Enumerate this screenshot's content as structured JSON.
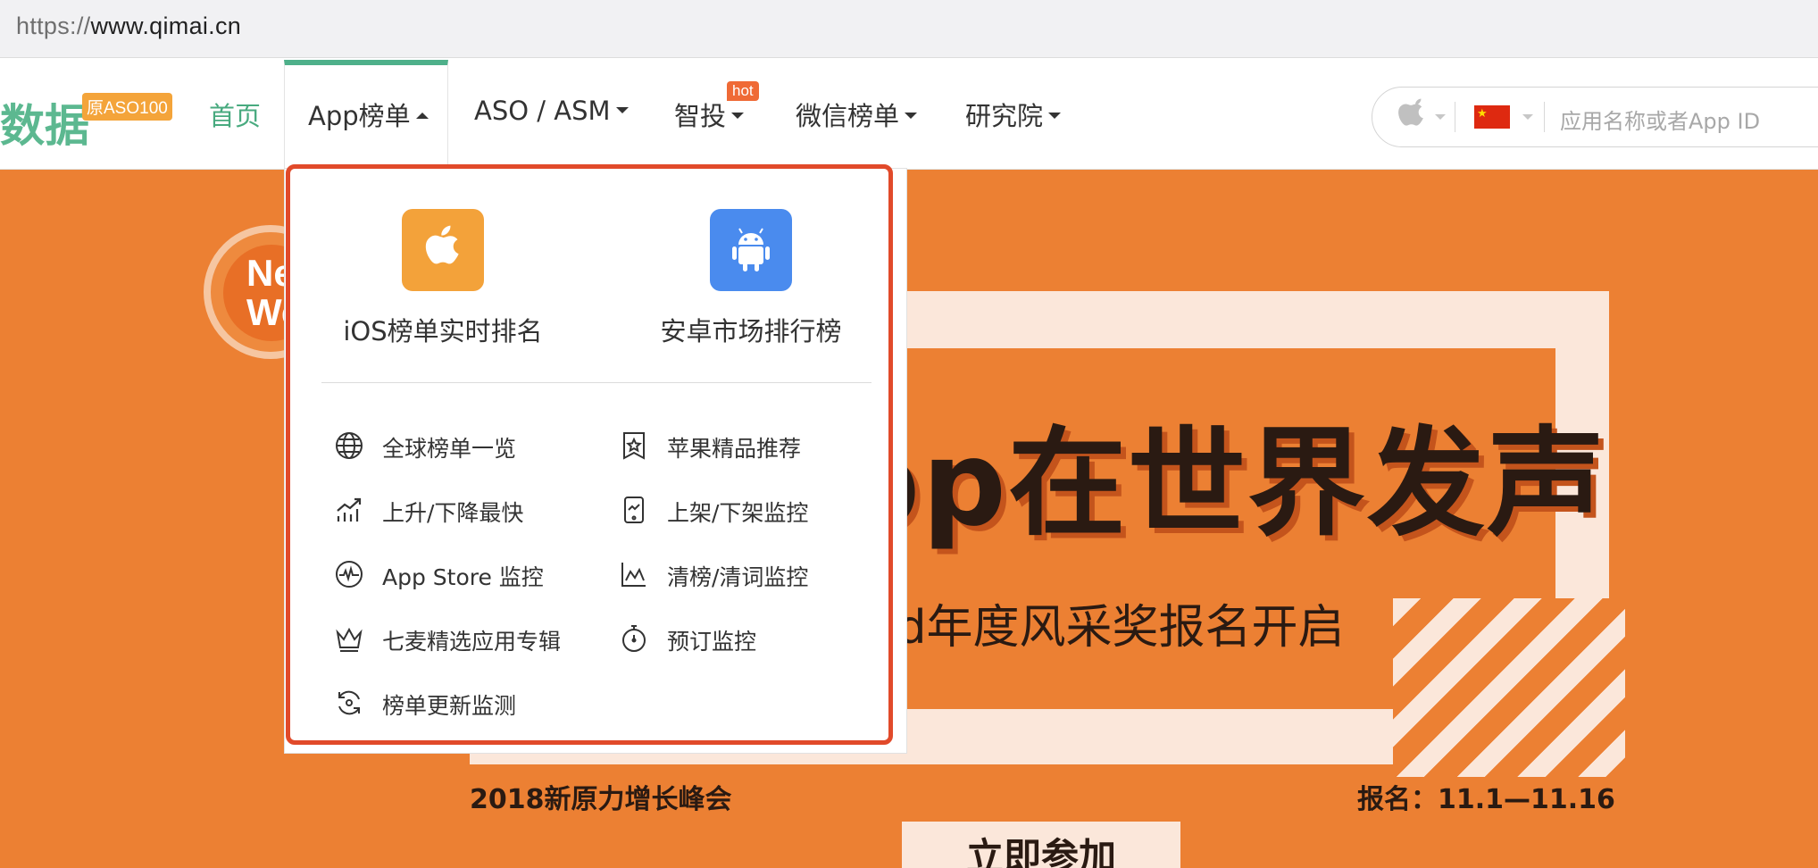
{
  "browser": {
    "url_scheme": "https://",
    "url_host": "www.qimai.cn"
  },
  "logo": {
    "text": "数据",
    "badge": "原ASO100"
  },
  "nav": {
    "home": "首页",
    "items": [
      {
        "label": "App榜单"
      },
      {
        "label": "ASO / ASM"
      },
      {
        "label": "智投",
        "badge": "hot"
      },
      {
        "label": "微信榜单"
      },
      {
        "label": "研究院"
      }
    ]
  },
  "search": {
    "placeholder": "应用名称或者App ID",
    "platform_icon": "apple-icon",
    "country_icon": "china-flag-icon"
  },
  "dropdown": {
    "tiles": [
      {
        "label": "iOS榜单实时排名",
        "icon": "apple-icon",
        "color": "#f3a23a"
      },
      {
        "label": "安卓市场排行榜",
        "icon": "android-icon",
        "color": "#4a8bee"
      }
    ],
    "items": [
      {
        "label": "全球榜单一览",
        "icon": "globe-icon"
      },
      {
        "label": "苹果精品推荐",
        "icon": "star-bookmark-icon"
      },
      {
        "label": "上升/下降最快",
        "icon": "trend-up-icon"
      },
      {
        "label": "上架/下架监控",
        "icon": "phone-monitor-icon"
      },
      {
        "label": "App Store 监控",
        "icon": "pulse-icon"
      },
      {
        "label": "清榜/清词监控",
        "icon": "line-chart-icon"
      },
      {
        "label": "七麦精选应用专辑",
        "icon": "crown-icon"
      },
      {
        "label": "预订监控",
        "icon": "stopwatch-icon"
      },
      {
        "label": "榜单更新监测",
        "icon": "refresh-icon"
      }
    ]
  },
  "banner": {
    "badge_text": "Ne We",
    "headline": "pp在世界发声",
    "subline": "ld年度风采奖报名开启",
    "event": "2018新原力增长峰会",
    "dates": "报名：11.1—11.16",
    "cta": "立即参加",
    "accent_color": "#ec8033"
  },
  "colors": {
    "brand_green": "#48aa7f",
    "highlight_red": "#e14a2a"
  }
}
